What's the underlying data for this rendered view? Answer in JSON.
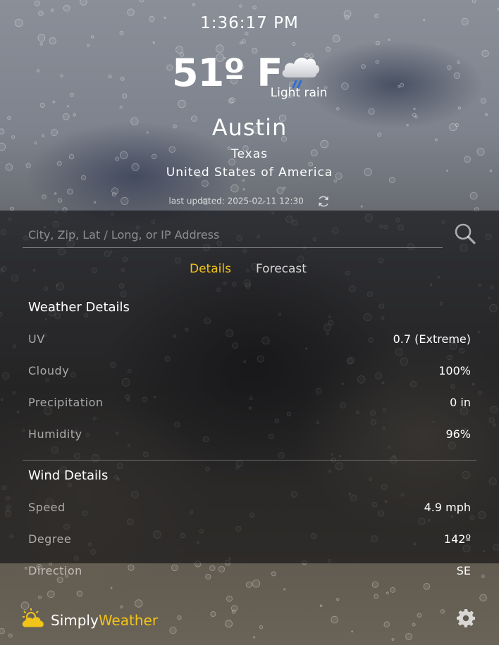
{
  "colors": {
    "accent": "#f2c318",
    "text": "#ffffff",
    "muted_text": "#b8b8b8",
    "panel": "#1a1a1e"
  },
  "header": {
    "time": "1:36:17 PM",
    "temperature": "51º F",
    "condition": "Light rain",
    "condition_icon": "cloud-rain-icon",
    "city": "Austin",
    "region": "Texas",
    "country": "United States of America",
    "last_updated": "last updated: 2025-02-11 12:30",
    "refresh_icon": "refresh-icon"
  },
  "search": {
    "placeholder": "City, Zip, Lat / Long, or IP Address",
    "value": "",
    "icon": "search-icon"
  },
  "tabs": [
    {
      "label": "Details",
      "active": true
    },
    {
      "label": "Forecast",
      "active": false
    }
  ],
  "weather_details": {
    "title": "Weather Details",
    "rows": [
      {
        "label": "UV",
        "value": "0.7 (Extreme)"
      },
      {
        "label": "Cloudy",
        "value": "100%"
      },
      {
        "label": "Precipitation",
        "value": "0 in"
      },
      {
        "label": "Humidity",
        "value": "96%"
      }
    ]
  },
  "wind_details": {
    "title": "Wind Details",
    "rows": [
      {
        "label": "Speed",
        "value": "4.9 mph"
      },
      {
        "label": "Degree",
        "value": "142º"
      },
      {
        "label": "Direction",
        "value": "SE"
      }
    ]
  },
  "footer": {
    "brand_part1": "Simply",
    "brand_part2": "Weather",
    "logo_icon": "sun-cloud-logo-icon",
    "settings_icon": "gear-icon"
  }
}
